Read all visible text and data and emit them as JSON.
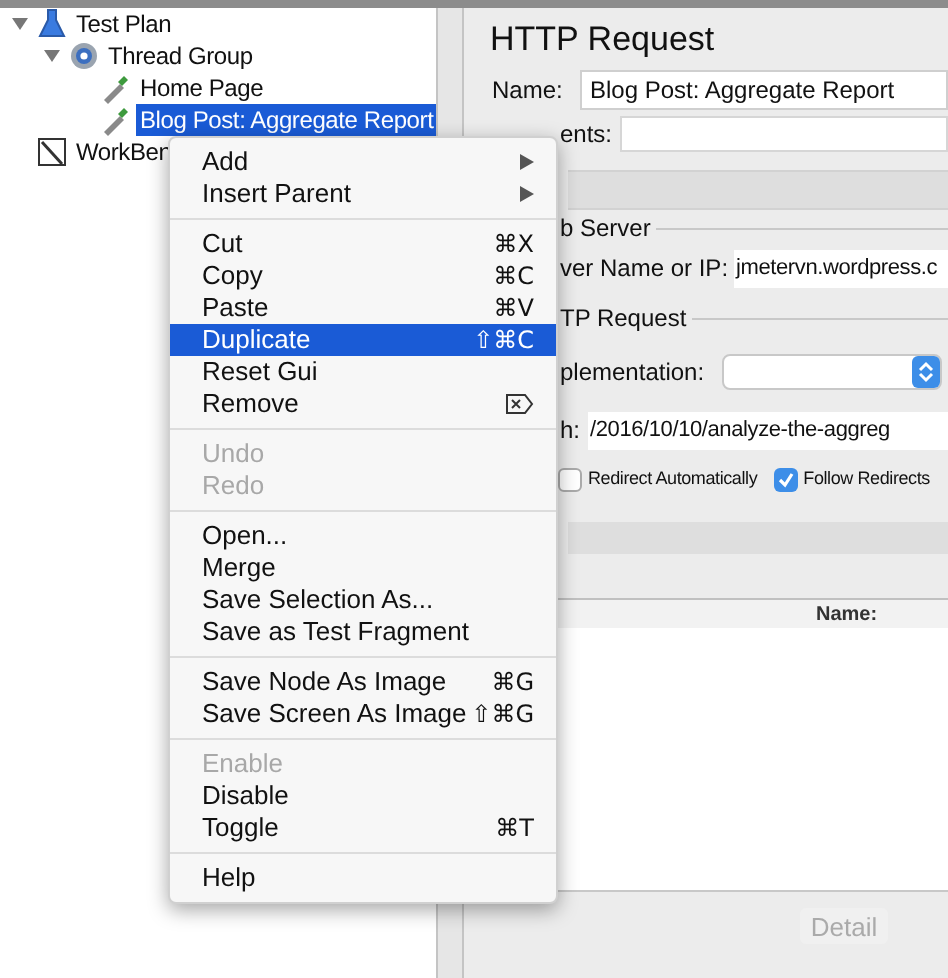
{
  "tree": [
    {
      "label": "Test Plan",
      "kind": "plan",
      "expanded": true,
      "selected": false,
      "children": [
        {
          "label": "Thread Group",
          "kind": "group",
          "expanded": true,
          "selected": false,
          "children": [
            {
              "label": "Home Page",
              "kind": "sampler",
              "selected": false
            },
            {
              "label": "Blog Post: Aggregate Report",
              "kind": "sampler",
              "selected": true
            }
          ]
        }
      ]
    },
    {
      "label": "WorkBen",
      "kind": "workbench",
      "selected": false
    }
  ],
  "panel": {
    "title": "HTTP Request",
    "name_label": "Name:",
    "name_value": "Blog Post: Aggregate Report",
    "comments_label": "ents:",
    "web_server_legend": "b Server",
    "server_label": "ver Name or IP:",
    "server_value": "jmetervn.wordpress.c",
    "http_request_legend": "TP Request",
    "implementation_label": "plementation:",
    "path_label": "h:",
    "path_value": "/2016/10/10/analyze-the-aggreg",
    "checkboxes": [
      {
        "label": "Redirect Automatically",
        "checked": false
      },
      {
        "label": "Follow Redirects",
        "checked": true
      }
    ],
    "table_header": "Name:",
    "detail_button": {
      "label": "Detail",
      "disabled": true
    }
  },
  "context_menu": {
    "sections": [
      [
        {
          "label": "Add",
          "kind": "submenu",
          "disabled": false,
          "selected": false
        },
        {
          "label": "Insert Parent",
          "kind": "submenu",
          "disabled": false,
          "selected": false
        }
      ],
      [
        {
          "label": "Cut",
          "kind": "command",
          "shortcut": "⌘X",
          "disabled": false,
          "selected": false
        },
        {
          "label": "Copy",
          "kind": "command",
          "shortcut": "⌘C",
          "disabled": false,
          "selected": false
        },
        {
          "label": "Paste",
          "kind": "command",
          "shortcut": "⌘V",
          "disabled": false,
          "selected": false
        },
        {
          "label": "Duplicate",
          "kind": "command",
          "shortcut": "⇧⌘C",
          "disabled": false,
          "selected": true
        },
        {
          "label": "Reset Gui",
          "kind": "command",
          "disabled": false,
          "selected": false
        },
        {
          "label": "Remove",
          "kind": "delete",
          "disabled": false,
          "selected": false
        }
      ],
      [
        {
          "label": "Undo",
          "kind": "command",
          "disabled": true,
          "selected": false
        },
        {
          "label": "Redo",
          "kind": "command",
          "disabled": true,
          "selected": false
        }
      ],
      [
        {
          "label": "Open...",
          "kind": "command",
          "disabled": false,
          "selected": false
        },
        {
          "label": "Merge",
          "kind": "command",
          "disabled": false,
          "selected": false
        },
        {
          "label": "Save Selection As...",
          "kind": "command",
          "disabled": false,
          "selected": false
        },
        {
          "label": "Save as Test Fragment",
          "kind": "command",
          "disabled": false,
          "selected": false
        }
      ],
      [
        {
          "label": "Save Node As Image",
          "kind": "command",
          "shortcut": "⌘G",
          "disabled": false,
          "selected": false
        },
        {
          "label": "Save Screen As Image",
          "kind": "command",
          "shortcut": "⇧⌘G",
          "disabled": false,
          "selected": false
        }
      ],
      [
        {
          "label": "Enable",
          "kind": "command",
          "disabled": true,
          "selected": false
        },
        {
          "label": "Disable",
          "kind": "command",
          "disabled": false,
          "selected": false
        },
        {
          "label": "Toggle",
          "kind": "command",
          "shortcut": "⌘T",
          "disabled": false,
          "selected": false
        }
      ],
      [
        {
          "label": "Help",
          "kind": "command",
          "disabled": false,
          "selected": false
        }
      ]
    ]
  }
}
